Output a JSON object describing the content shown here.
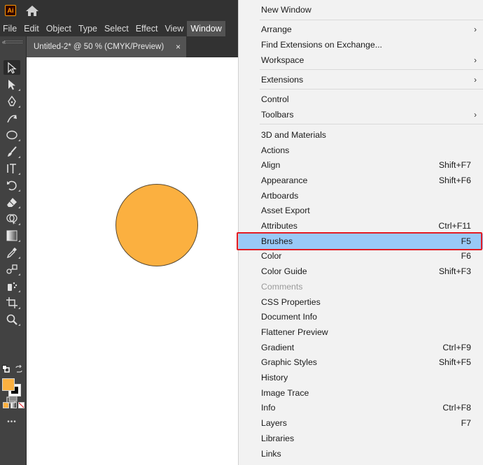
{
  "app": {
    "logo_text": "Ai",
    "menubar": [
      "File",
      "Edit",
      "Object",
      "Type",
      "Select",
      "Effect",
      "View",
      "Window"
    ],
    "active_menu": "Window"
  },
  "document_tab": {
    "title": "Untitled-2* @ 50 % (CMYK/Preview)",
    "close_glyph": "×"
  },
  "colors": {
    "fill": "#fbb040",
    "stroke": "#000000",
    "menu_highlight": "#99c9f7",
    "callout_border": "#e31b23"
  },
  "toolbar": {
    "tools": [
      "selection-tool",
      "direct-selection-tool",
      "pen-tool",
      "curvature-tool",
      "ellipse-tool",
      "paintbrush-tool",
      "type-tool",
      "rotate-tool",
      "eraser-tool",
      "shape-builder-tool",
      "gradient-tool",
      "eyedropper-tool",
      "blend-tool",
      "symbol-sprayer-tool",
      "artboard-tool",
      "zoom-tool"
    ],
    "more_glyph": "•••"
  },
  "window_menu": {
    "items": [
      {
        "label": "New Window",
        "shortcut": "",
        "submenu": false
      },
      {
        "label": "Arrange",
        "shortcut": "",
        "submenu": true
      },
      {
        "label": "Find Extensions on Exchange...",
        "shortcut": "",
        "submenu": false
      },
      {
        "label": "Workspace",
        "shortcut": "",
        "submenu": true
      },
      {
        "label": "Extensions",
        "shortcut": "",
        "submenu": true
      },
      {
        "label": "Control",
        "shortcut": "",
        "submenu": false
      },
      {
        "label": "Toolbars",
        "shortcut": "",
        "submenu": true
      },
      {
        "label": "3D and Materials",
        "shortcut": "",
        "submenu": false
      },
      {
        "label": "Actions",
        "shortcut": "",
        "submenu": false
      },
      {
        "label": "Align",
        "shortcut": "Shift+F7",
        "submenu": false
      },
      {
        "label": "Appearance",
        "shortcut": "Shift+F6",
        "submenu": false
      },
      {
        "label": "Artboards",
        "shortcut": "",
        "submenu": false
      },
      {
        "label": "Asset Export",
        "shortcut": "",
        "submenu": false
      },
      {
        "label": "Attributes",
        "shortcut": "Ctrl+F11",
        "submenu": false
      },
      {
        "label": "Brushes",
        "shortcut": "F5",
        "submenu": false,
        "highlighted": true
      },
      {
        "label": "Color",
        "shortcut": "F6",
        "submenu": false
      },
      {
        "label": "Color Guide",
        "shortcut": "Shift+F3",
        "submenu": false
      },
      {
        "label": "Comments",
        "shortcut": "",
        "submenu": false,
        "disabled": true
      },
      {
        "label": "CSS Properties",
        "shortcut": "",
        "submenu": false
      },
      {
        "label": "Document Info",
        "shortcut": "",
        "submenu": false
      },
      {
        "label": "Flattener Preview",
        "shortcut": "",
        "submenu": false
      },
      {
        "label": "Gradient",
        "shortcut": "Ctrl+F9",
        "submenu": false
      },
      {
        "label": "Graphic Styles",
        "shortcut": "Shift+F5",
        "submenu": false
      },
      {
        "label": "History",
        "shortcut": "",
        "submenu": false
      },
      {
        "label": "Image Trace",
        "shortcut": "",
        "submenu": false
      },
      {
        "label": "Info",
        "shortcut": "Ctrl+F8",
        "submenu": false
      },
      {
        "label": "Layers",
        "shortcut": "F7",
        "submenu": false
      },
      {
        "label": "Libraries",
        "shortcut": "",
        "submenu": false
      },
      {
        "label": "Links",
        "shortcut": "",
        "submenu": false
      }
    ],
    "arrow_glyph": "›"
  }
}
